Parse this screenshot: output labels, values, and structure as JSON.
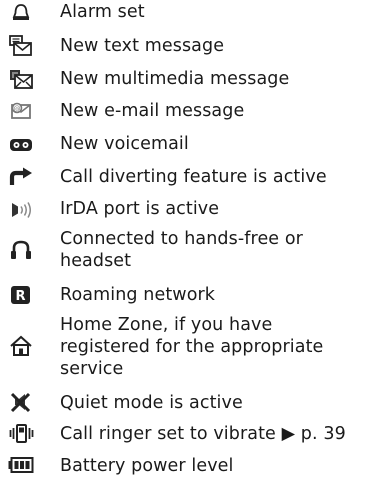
{
  "indicators": [
    {
      "icon": "alarm-bell-icon",
      "text": "Alarm set"
    },
    {
      "icon": "new-text-message-icon",
      "text": "New text message"
    },
    {
      "icon": "new-multimedia-message-icon",
      "text": "New multimedia message"
    },
    {
      "icon": "new-email-message-icon",
      "text": "New e-mail message"
    },
    {
      "icon": "voicemail-icon",
      "text": "New voicemail"
    },
    {
      "icon": "call-divert-icon",
      "text": "Call diverting feature is active"
    },
    {
      "icon": "irda-port-icon",
      "text": "IrDA port is active"
    },
    {
      "icon": "headset-icon",
      "text": "Connected to hands-free or",
      "text2": "headset"
    },
    {
      "icon": "roaming-icon",
      "text": "Roaming network"
    },
    {
      "icon": "home-zone-icon",
      "text": "Home Zone, if you have",
      "text2": "registered for the appropriate",
      "text3": "service"
    },
    {
      "icon": "quiet-mode-icon",
      "text": "Quiet mode is active"
    },
    {
      "icon": "vibrate-icon",
      "text": "Call ringer set to vibrate ▶ p. 39"
    },
    {
      "icon": "battery-level-icon",
      "text": "Battery power level"
    }
  ]
}
